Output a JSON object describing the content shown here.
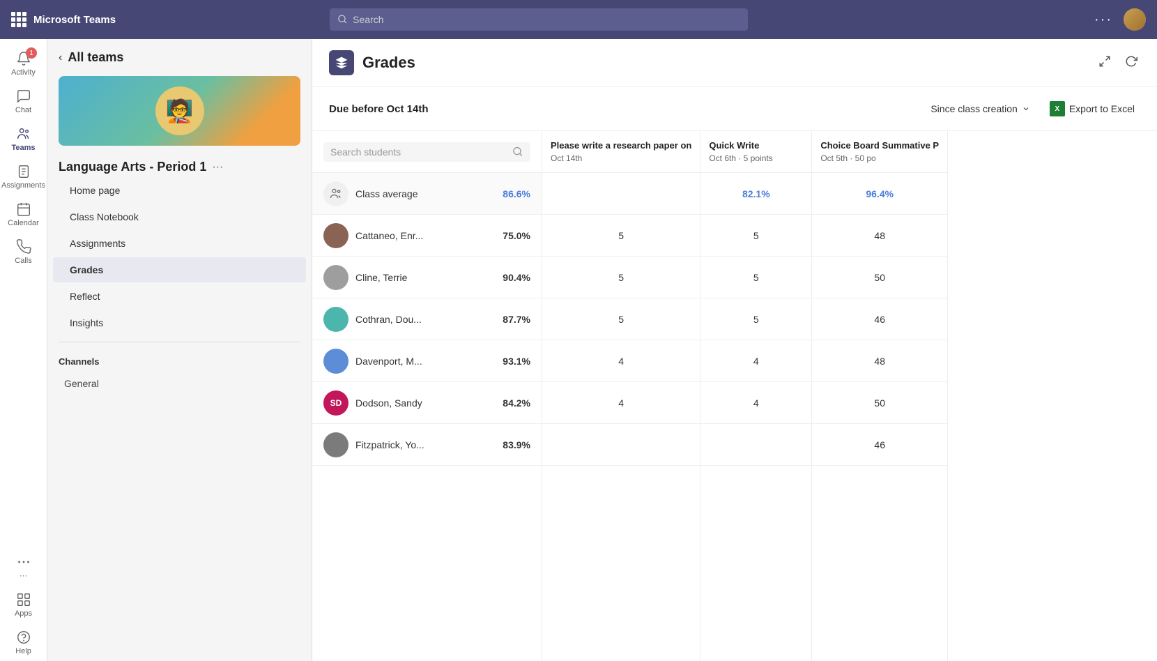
{
  "app": {
    "title": "Microsoft Teams"
  },
  "topbar": {
    "search_placeholder": "Search",
    "more_label": "···"
  },
  "sidebar": {
    "items": [
      {
        "id": "activity",
        "label": "Activity",
        "badge": "1"
      },
      {
        "id": "chat",
        "label": "Chat",
        "badge": null
      },
      {
        "id": "teams",
        "label": "Teams",
        "badge": null,
        "active": true
      },
      {
        "id": "assignments",
        "label": "Assignments",
        "badge": null
      },
      {
        "id": "calendar",
        "label": "Calendar",
        "badge": null
      },
      {
        "id": "calls",
        "label": "Calls",
        "badge": null
      },
      {
        "id": "more",
        "label": "···",
        "badge": null
      },
      {
        "id": "apps",
        "label": "Apps",
        "badge": null
      },
      {
        "id": "help",
        "label": "Help",
        "badge": null
      }
    ]
  },
  "left_panel": {
    "back_label": "All teams",
    "class_name": "Language Arts - Period 1",
    "nav_items": [
      {
        "id": "homepage",
        "label": "Home page",
        "active": false
      },
      {
        "id": "classnotebook",
        "label": "Class Notebook",
        "active": false
      },
      {
        "id": "assignments",
        "label": "Assignments",
        "active": false
      },
      {
        "id": "grades",
        "label": "Grades",
        "active": true
      },
      {
        "id": "reflect",
        "label": "Reflect",
        "active": false
      },
      {
        "id": "insights",
        "label": "Insights",
        "active": false
      }
    ],
    "channels_label": "Channels",
    "channels": [
      {
        "id": "general",
        "label": "General"
      }
    ]
  },
  "grades_page": {
    "title": "Grades",
    "due_label": "Due before Oct 14th",
    "filter_label": "Since class creation",
    "export_label": "Export to Excel",
    "search_students_placeholder": "Search students",
    "students": [
      {
        "id": "avg",
        "name": "Class average",
        "pct": "86.6%",
        "is_avg": true,
        "avatar_initials": "",
        "avatar_color": ""
      },
      {
        "id": "cattaneo",
        "name": "Cattaneo, Enr...",
        "pct": "75.0%",
        "is_avg": false,
        "avatar_color": "av-brown"
      },
      {
        "id": "cline",
        "name": "Cline, Terrie",
        "pct": "90.4%",
        "is_avg": false,
        "avatar_color": "av-gray"
      },
      {
        "id": "cothran",
        "name": "Cothran, Dou...",
        "pct": "87.7%",
        "is_avg": false,
        "avatar_color": "av-teal"
      },
      {
        "id": "davenport",
        "name": "Davenport, M...",
        "pct": "93.1%",
        "is_avg": false,
        "avatar_color": "av-blue"
      },
      {
        "id": "dodson",
        "name": "Dodson, Sandy",
        "pct": "84.2%",
        "is_avg": false,
        "avatar_color": "av-sd",
        "avatar_initials": "SD"
      },
      {
        "id": "fitzpatrick",
        "name": "Fitzpatrick, Yo...",
        "pct": "83.9%",
        "is_avg": false,
        "avatar_color": "av-fitz"
      }
    ],
    "assignments": [
      {
        "id": "research",
        "name": "Please write a research paper on",
        "date": "Oct 14th",
        "points": null,
        "scores": [
          "",
          "5",
          "5",
          "5",
          "4",
          "4",
          ""
        ]
      },
      {
        "id": "quickwrite",
        "name": "Quick Write",
        "date": "Oct 6th",
        "points": "5 points",
        "scores": [
          "82.1%",
          "5",
          "5",
          "5",
          "4",
          "4",
          ""
        ]
      },
      {
        "id": "choiceboard",
        "name": "Choice Board Summative P",
        "date": "Oct 5th",
        "points": "50 po",
        "scores": [
          "96.4%",
          "48",
          "50",
          "46",
          "48",
          "50",
          "46"
        ]
      }
    ]
  }
}
